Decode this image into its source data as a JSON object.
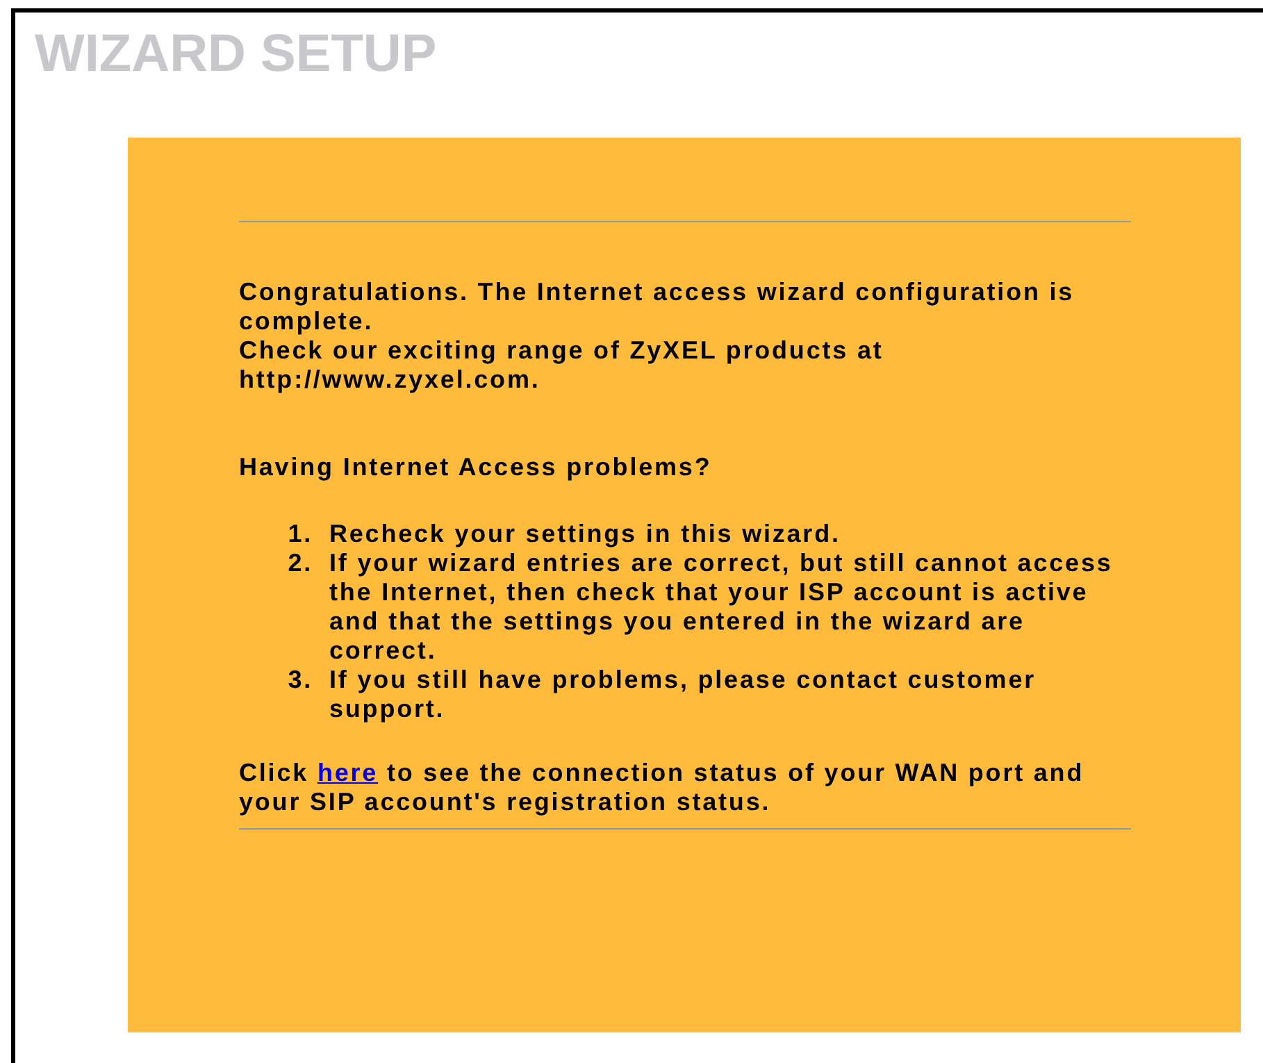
{
  "title": "WIZARD SETUP",
  "messages": [
    "Congratulations. The Internet access wizard configuration is complete.",
    "Check our exciting range of ZyXEL products at http://www.zyxel.com."
  ],
  "problems_heading": "Having Internet Access problems?",
  "steps": [
    {
      "number": "1.",
      "text": "Recheck your settings in this wizard."
    },
    {
      "number": "2.",
      "text": "If your wizard entries are correct, but still cannot access the Internet, then check that your ISP account is active and that the settings you entered in the wizard are correct."
    },
    {
      "number": "3.",
      "text": "If you still have problems, please contact customer support."
    }
  ],
  "footer": {
    "before": "Click",
    "link": "here",
    "after": "to see the connection status of your WAN port and your SIP account's registration status."
  }
}
